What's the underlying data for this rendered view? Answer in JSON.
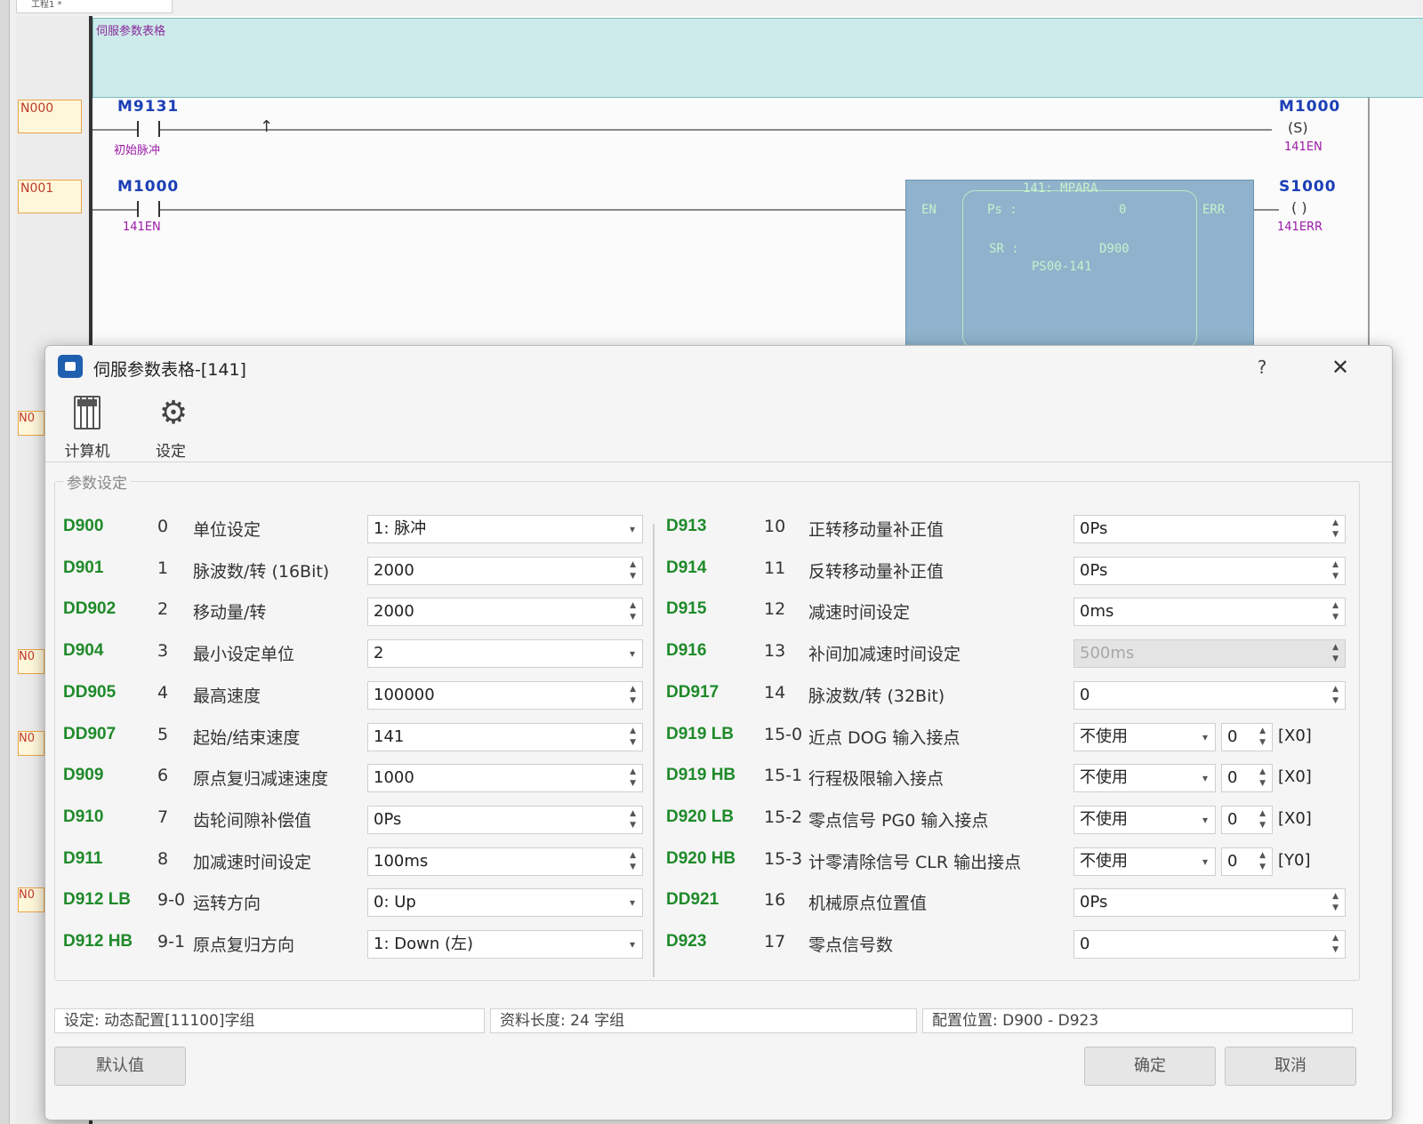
{
  "editor": {
    "tab_title": "工程1 *",
    "comment": "伺服参数表格",
    "rungs": [
      {
        "label": "N000",
        "contact": "M9131",
        "contact_comment": "初始脉冲",
        "coil": "M1000",
        "coil_symbol": "(S)",
        "coil_comment": "141EN"
      },
      {
        "label": "N001",
        "contact": "M1000",
        "contact_comment": "141EN",
        "coil": "S1000",
        "coil_symbol": "( )",
        "coil_comment": "141ERR"
      }
    ],
    "function_block": {
      "title": "141: MPARA",
      "en": "EN",
      "err": "ERR",
      "ps_label": "Ps :",
      "ps_value": "0",
      "sr_label": "SR :",
      "sr_value": "D900",
      "name": "PS00-141"
    },
    "stub_label": "N0"
  },
  "dialog": {
    "title": "伺服参数表格-[141]",
    "help": "?",
    "close": "✕",
    "toolbar": [
      {
        "label": "计算机",
        "icon": "calculator-icon"
      },
      {
        "label": "设定",
        "icon": "gear-icon"
      }
    ],
    "group_title": "参数设定",
    "left_params": [
      {
        "reg": "D900",
        "num": "0",
        "name": "单位设定",
        "value": "1: 脉冲",
        "ctrl": "dropdown"
      },
      {
        "reg": "D901",
        "num": "1",
        "name": "脉波数/转 (16Bit)",
        "value": "2000",
        "ctrl": "spin"
      },
      {
        "reg": "DD902",
        "num": "2",
        "name": "移动量/转",
        "value": "2000",
        "ctrl": "spin"
      },
      {
        "reg": "D904",
        "num": "3",
        "name": "最小设定单位",
        "value": "2",
        "ctrl": "dropdown"
      },
      {
        "reg": "DD905",
        "num": "4",
        "name": "最高速度",
        "value": "100000",
        "ctrl": "spin"
      },
      {
        "reg": "DD907",
        "num": "5",
        "name": "起始/结束速度",
        "value": "141",
        "ctrl": "spin"
      },
      {
        "reg": "D909",
        "num": "6",
        "name": "原点复归减速速度",
        "value": "1000",
        "ctrl": "spin"
      },
      {
        "reg": "D910",
        "num": "7",
        "name": "齿轮间隙补偿值",
        "value": "0Ps",
        "ctrl": "spin"
      },
      {
        "reg": "D911",
        "num": "8",
        "name": "加减速时间设定",
        "value": "100ms",
        "ctrl": "spin"
      },
      {
        "reg": "D912 LB",
        "num": "9-0",
        "name": "运转方向",
        "value": "0: Up",
        "ctrl": "dropdown"
      },
      {
        "reg": "D912 HB",
        "num": "9-1",
        "name": "原点复归方向",
        "value": "1: Down (左)",
        "ctrl": "dropdown"
      }
    ],
    "right_params": [
      {
        "reg": "D913",
        "num": "10",
        "name": "正转移动量补正值",
        "value": "0Ps",
        "ctrl": "spin"
      },
      {
        "reg": "D914",
        "num": "11",
        "name": "反转移动量补正值",
        "value": "0Ps",
        "ctrl": "spin"
      },
      {
        "reg": "D915",
        "num": "12",
        "name": "减速时间设定",
        "value": "0ms",
        "ctrl": "spin"
      },
      {
        "reg": "D916",
        "num": "13",
        "name": "补间加减速时间设定",
        "value": "500ms",
        "ctrl": "spin",
        "disabled": true
      },
      {
        "reg": "DD917",
        "num": "14",
        "name": "脉波数/转 (32Bit)",
        "value": "0",
        "ctrl": "spin"
      },
      {
        "reg": "D919 LB",
        "num": "15-0",
        "name": "近点 DOG 输入接点",
        "value": "不使用",
        "ctrl": "io",
        "sub_value": "0",
        "suffix": "[X0]"
      },
      {
        "reg": "D919 HB",
        "num": "15-1",
        "name": "行程极限输入接点",
        "value": "不使用",
        "ctrl": "io",
        "sub_value": "0",
        "suffix": "[X0]"
      },
      {
        "reg": "D920 LB",
        "num": "15-2",
        "name": "零点信号 PG0 输入接点",
        "value": "不使用",
        "ctrl": "io",
        "sub_value": "0",
        "suffix": "[X0]"
      },
      {
        "reg": "D920 HB",
        "num": "15-3",
        "name": "计零清除信号 CLR 输出接点",
        "value": "不使用",
        "ctrl": "io",
        "sub_value": "0",
        "suffix": "[Y0]"
      },
      {
        "reg": "DD921",
        "num": "16",
        "name": "机械原点位置值",
        "value": "0Ps",
        "ctrl": "spin"
      },
      {
        "reg": "D923",
        "num": "17",
        "name": "零点信号数",
        "value": "0",
        "ctrl": "spin"
      }
    ],
    "status": {
      "setting": "设定: 动态配置[11100]字组",
      "length": "资料长度: 24 字组",
      "location": "配置位置: D900 - D923"
    },
    "buttons": {
      "default": "默认值",
      "ok": "确定",
      "cancel": "取消"
    }
  }
}
